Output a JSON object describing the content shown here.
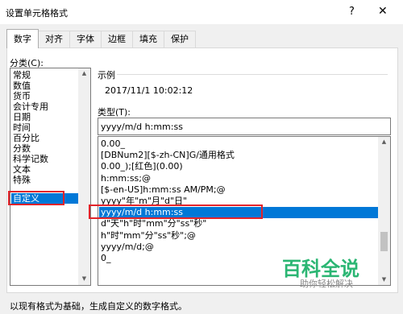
{
  "dialog": {
    "title": "设置单元格格式",
    "help": "?",
    "close": "✕"
  },
  "tabs": [
    "数字",
    "对齐",
    "字体",
    "边框",
    "填充",
    "保护"
  ],
  "category": {
    "label": "分类(C):",
    "items": [
      "常规",
      "数值",
      "货币",
      "会计专用",
      "日期",
      "时间",
      "百分比",
      "分数",
      "科学记数",
      "文本",
      "特殊",
      "自定义"
    ],
    "selected": "自定义"
  },
  "sample": {
    "label": "示例",
    "value": "2017/11/1 10:02:12"
  },
  "type": {
    "label": "类型(T):",
    "value": "yyyy/m/d h:mm:ss",
    "items": [
      "0.00_",
      "[DBNum2][$-zh-CN]G/通用格式",
      "0.00_);[红色](0.00)",
      "h:mm:ss;@",
      "[$-en-US]h:mm:ss AM/PM;@",
      "yyyy\"年\"m\"月\"d\"日\"",
      "yyyy/m/d h:mm:ss",
      "d\"天\"h\"时\"mm\"分\"ss\"秒\"",
      "h\"时\"mm\"分\"ss\"秒\";@",
      "yyyy/m/d;@",
      "0_"
    ],
    "selected": "yyyy/m/d h:mm:ss"
  },
  "footer": "以现有格式为基础，生成自定义的数字格式。",
  "watermark": {
    "title": "百科全说",
    "subtitle": "助你轻松解决"
  },
  "colors": {
    "selection": "#0078d7",
    "highlight_box": "#e2232a",
    "watermark": "#2bb673"
  },
  "icons": {
    "scroll_up": "chevron-up-icon",
    "scroll_down": "chevron-down-icon"
  }
}
